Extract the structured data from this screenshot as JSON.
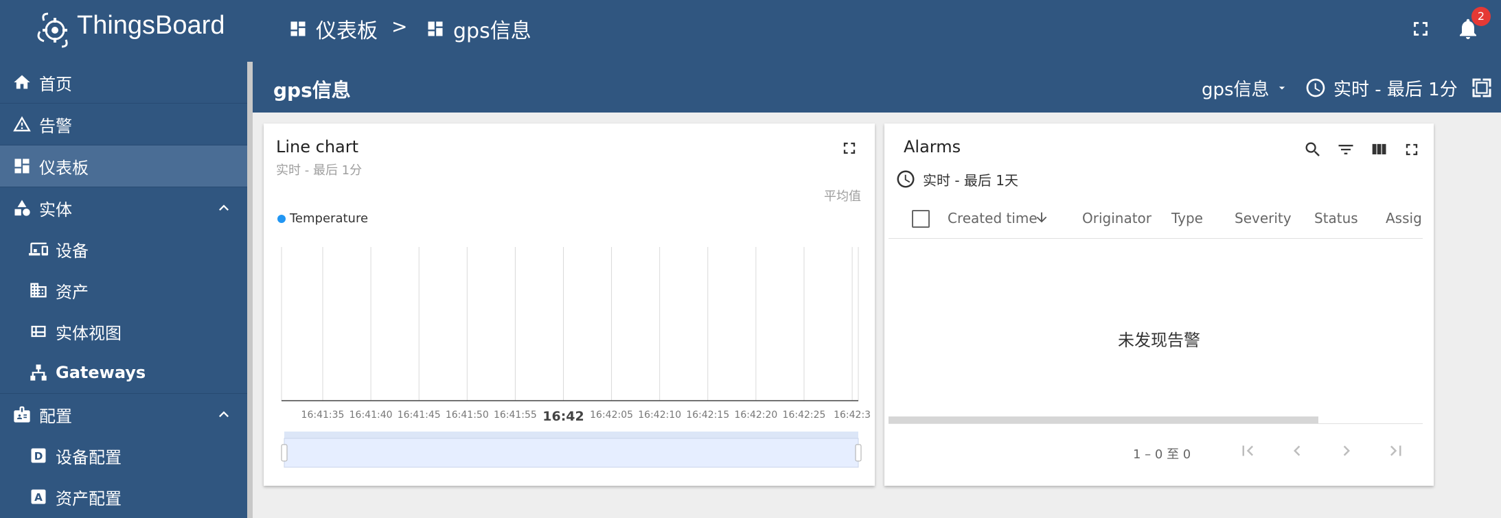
{
  "app": {
    "brand": "ThingsBoard",
    "notification_count": "2",
    "breadcrumb": [
      {
        "label": "仪表板",
        "icon": "dashboard-icon"
      },
      {
        "label": "gps信息",
        "icon": "dashboard-icon"
      }
    ],
    "breadcrumb_separator": ">"
  },
  "sidebar": {
    "items": [
      {
        "label": "首页",
        "icon": "home-icon"
      },
      {
        "label": "告警",
        "icon": "warning-icon"
      },
      {
        "label": "仪表板",
        "icon": "dashboard-icon",
        "active": true
      },
      {
        "label": "实体",
        "icon": "entities-icon",
        "expanded": true
      },
      {
        "label": "设备",
        "icon": "devices-icon"
      },
      {
        "label": "资产",
        "icon": "assets-icon"
      },
      {
        "label": "实体视图",
        "icon": "entity-view-icon"
      },
      {
        "label": "Gateways",
        "icon": "gateway-icon"
      },
      {
        "label": "配置",
        "icon": "profiles-icon",
        "expanded": true
      },
      {
        "label": "设备配置",
        "icon": "device-profile-icon"
      },
      {
        "label": "资产配置",
        "icon": "asset-profile-icon"
      }
    ]
  },
  "dashboard": {
    "title": "gps信息",
    "state": "gps信息",
    "timewindow": "实时 - 最后 1分"
  },
  "line_widget": {
    "title": "Line chart",
    "subtitle": "实时 - 最后 1分",
    "aggregation": "平均值",
    "colors": {
      "series": "#2196f3"
    }
  },
  "chart_data": {
    "type": "line",
    "title": "Line chart",
    "x_ticks": [
      "16:41:35",
      "16:41:40",
      "16:41:45",
      "16:41:50",
      "16:41:55",
      "16:42",
      "16:42:05",
      "16:42:10",
      "16:42:15",
      "16:42:20",
      "16:42:25",
      "16:42:3"
    ],
    "series": [
      {
        "name": "Temperature",
        "values": []
      }
    ],
    "legend": "top-left",
    "grid": true
  },
  "alarms_widget": {
    "title": "Alarms",
    "timewindow": "实时 - 最后 1天",
    "columns": [
      "Created time",
      "Originator",
      "Type",
      "Severity",
      "Status",
      "Assign"
    ],
    "empty_text": "未发现告警",
    "pager_range": "1 – 0 至 0"
  }
}
